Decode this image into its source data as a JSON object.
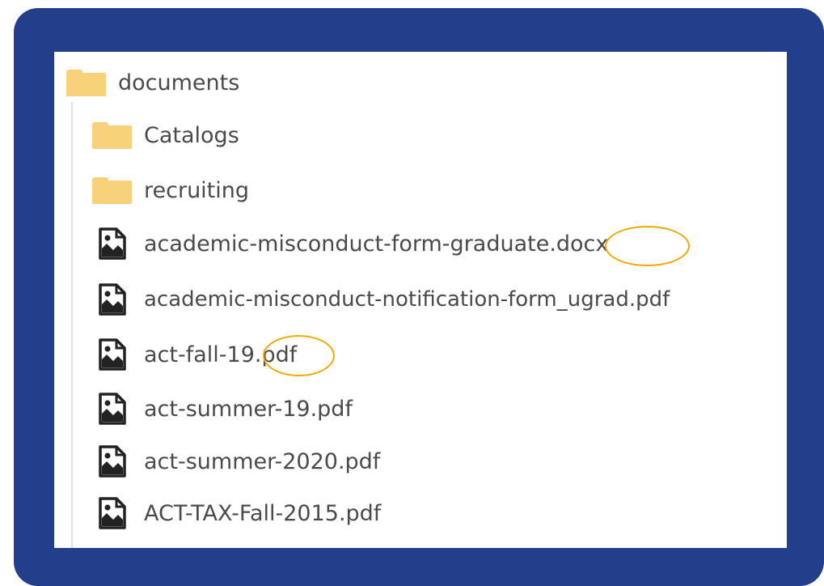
{
  "tree": {
    "root": {
      "label": "documents",
      "icon": "folder-icon"
    },
    "folders": [
      {
        "label": "Catalogs",
        "icon": "folder-icon"
      },
      {
        "label": "recruiting",
        "icon": "folder-icon"
      }
    ],
    "files": [
      {
        "label": "academic-misconduct-form-graduate.docx",
        "icon": "file-image-icon"
      },
      {
        "label": "academic-misconduct-notification-form_ugrad.pdf",
        "icon": "file-image-icon"
      },
      {
        "label": "act-fall-19.pdf",
        "icon": "file-image-icon"
      },
      {
        "label": "act-summer-19.pdf",
        "icon": "file-image-icon"
      },
      {
        "label": "act-summer-2020.pdf",
        "icon": "file-image-icon"
      },
      {
        "label": "ACT-TAX-Fall-2015.pdf",
        "icon": "file-image-icon"
      }
    ]
  },
  "highlights": [
    {
      "target": "extension .docx",
      "color": "#f2a900"
    },
    {
      "target": "extension .pdf",
      "color": "#f2a900"
    }
  ],
  "colors": {
    "frame": "#233e8b",
    "folder": "#f7d27a",
    "text": "#4a4a4a",
    "highlight": "#f2a900"
  }
}
